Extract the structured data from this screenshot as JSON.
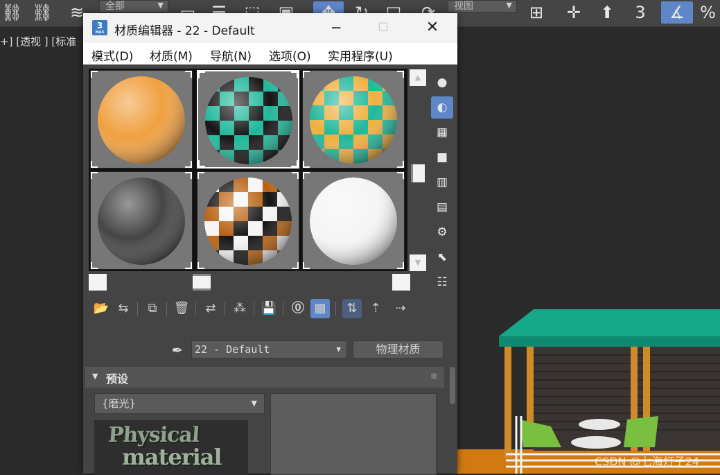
{
  "toolbar": {
    "selection_filter": "全部",
    "coord_system": "视图",
    "snap_angle": "3",
    "percent_snap": "%"
  },
  "viewport": {
    "label": "+] [透视 ] [标准"
  },
  "material_editor": {
    "app_icon_text": "3",
    "app_icon_sub": "MAX",
    "title": "材质编辑器 - 22 - Default",
    "menu": [
      "模式(D)",
      "材质(M)",
      "导航(N)",
      "选项(O)",
      "实用程序(U)"
    ],
    "slots": [
      {
        "kind": "solid",
        "color": "#f0a040"
      },
      {
        "kind": "checker",
        "colorA": "#1fb89a",
        "colorB": "#151515"
      },
      {
        "kind": "checker",
        "colorA": "#1fb89a",
        "colorB": "#f0b040"
      },
      {
        "kind": "solid",
        "color": "#454545"
      },
      {
        "kind": "checker",
        "colorA": "#b8600f",
        "colorB": "#151515",
        "colorC": "#f5f5f5"
      },
      {
        "kind": "solid",
        "color": "#f5f5f5"
      }
    ],
    "material_name": "22 - Default",
    "material_type": "物理材质",
    "rollout_title": "预设",
    "preset_value": "{磨光}",
    "preview_line1": "Physical",
    "preview_line2": "material"
  },
  "watermark": "CSDN @七海灯子24"
}
